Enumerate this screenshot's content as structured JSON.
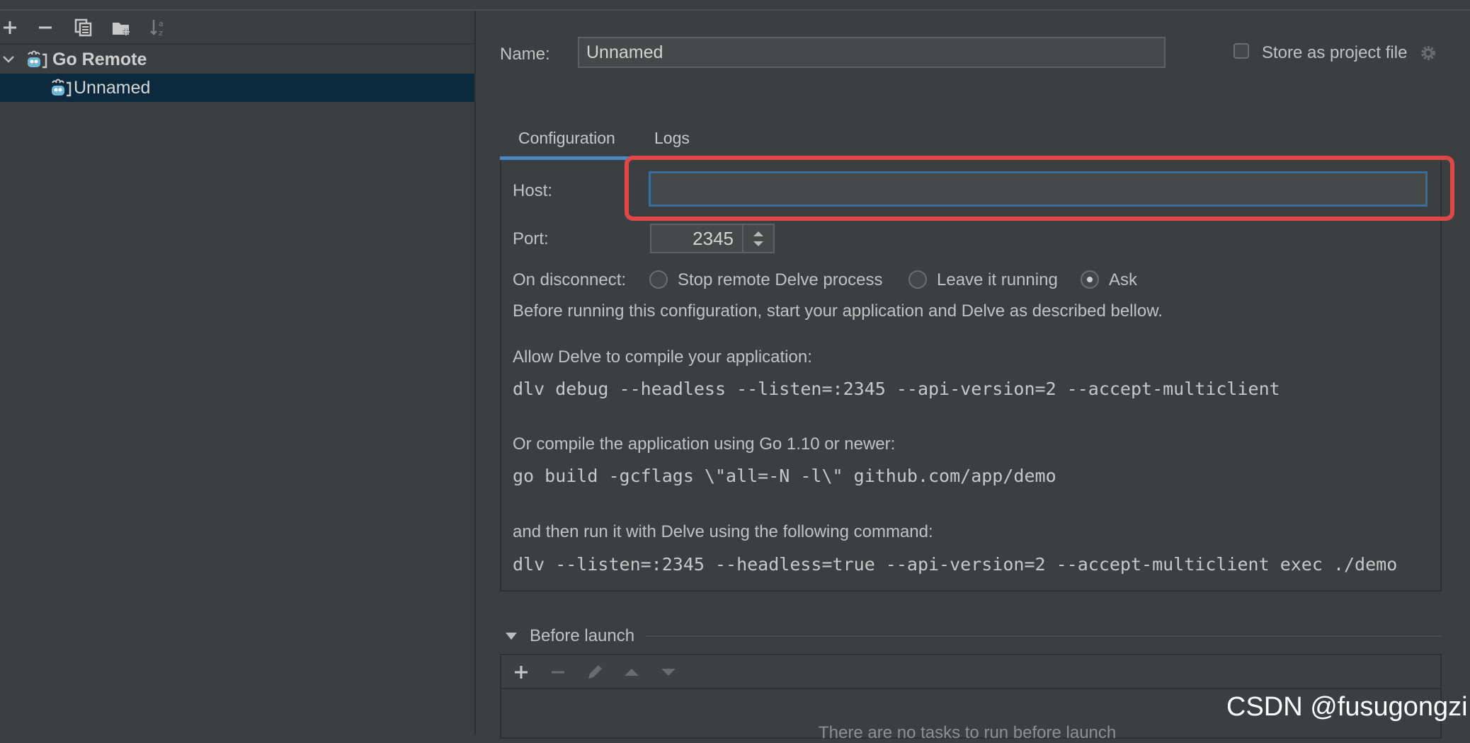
{
  "toolbar": {
    "icons": [
      "plus-icon",
      "minus-icon",
      "copy-icon",
      "folder-add-icon",
      "sort-icon"
    ]
  },
  "tree": {
    "group_label": "Go Remote",
    "item_label": "Unnamed"
  },
  "form": {
    "name_label": "Name:",
    "name_value": "Unnamed",
    "store_label": "Store as project file",
    "tabs": [
      {
        "label": "Configuration"
      },
      {
        "label": "Logs"
      }
    ],
    "host_label": "Host:",
    "host_value": "",
    "port_label": "Port:",
    "port_value": "2345",
    "on_disconnect_label": "On disconnect:",
    "radios": [
      {
        "label": "Stop remote Delve process"
      },
      {
        "label": "Leave it running"
      },
      {
        "label": "Ask"
      }
    ],
    "info": "Before running this configuration, start your application and Delve as described bellow.",
    "allow_label": "Allow Delve to compile your application:",
    "cmd1": "dlv debug --headless --listen=:2345 --api-version=2 --accept-multiclient",
    "compile_label": "Or compile the application using Go 1.10 or newer:",
    "cmd2": "go build -gcflags \\\"all=-N -l\\\" github.com/app/demo",
    "run_label": "and then run it with Delve using the following command:",
    "cmd3": "dlv --listen=:2345 --headless=true --api-version=2 --accept-multiclient exec ./demo"
  },
  "before_launch": {
    "label": "Before launch",
    "partial_text": "There are no tasks to run before launch"
  },
  "watermark": "CSDN @fusugongzi",
  "colors": {
    "accent": "#4a88c7",
    "highlight": "#e04848",
    "selection": "#0d293e"
  }
}
